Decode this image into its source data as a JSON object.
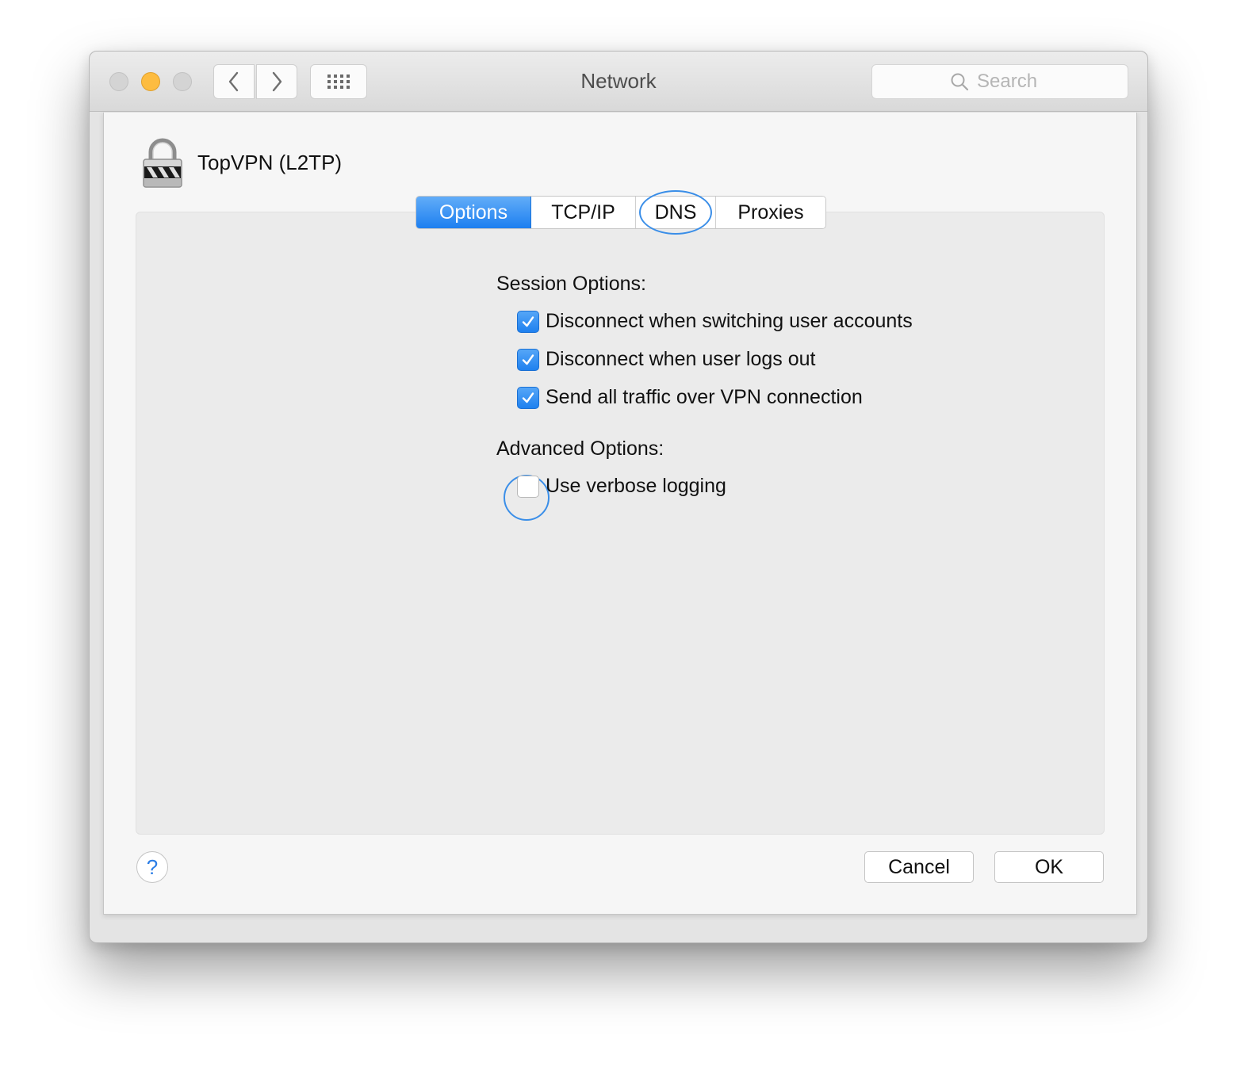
{
  "window": {
    "title": "Network"
  },
  "toolbar": {
    "back_icon": "chevron-left-icon",
    "forward_icon": "chevron-right-icon",
    "grid_icon": "grid-icon"
  },
  "search": {
    "placeholder": "Search",
    "icon": "search-icon"
  },
  "connection": {
    "name": "TopVPN (L2TP)",
    "icon": "vpn-lock-icon"
  },
  "tabs": [
    {
      "label": "Options",
      "active": true
    },
    {
      "label": "TCP/IP",
      "active": false
    },
    {
      "label": "DNS",
      "active": false
    },
    {
      "label": "Proxies",
      "active": false
    }
  ],
  "session": {
    "heading": "Session Options:",
    "options": [
      {
        "label": "Disconnect when switching user accounts",
        "checked": true
      },
      {
        "label": "Disconnect when user logs out",
        "checked": true
      },
      {
        "label": "Send all traffic over VPN connection",
        "checked": true
      }
    ]
  },
  "advanced": {
    "heading": "Advanced Options:",
    "options": [
      {
        "label": "Use verbose logging",
        "checked": false
      }
    ]
  },
  "footer": {
    "help_label": "?",
    "cancel_label": "Cancel",
    "ok_label": "OK"
  },
  "colors": {
    "accent": "#1d7ff0",
    "minimize": "#fdbc40",
    "annotation": "#3a8ee8"
  }
}
